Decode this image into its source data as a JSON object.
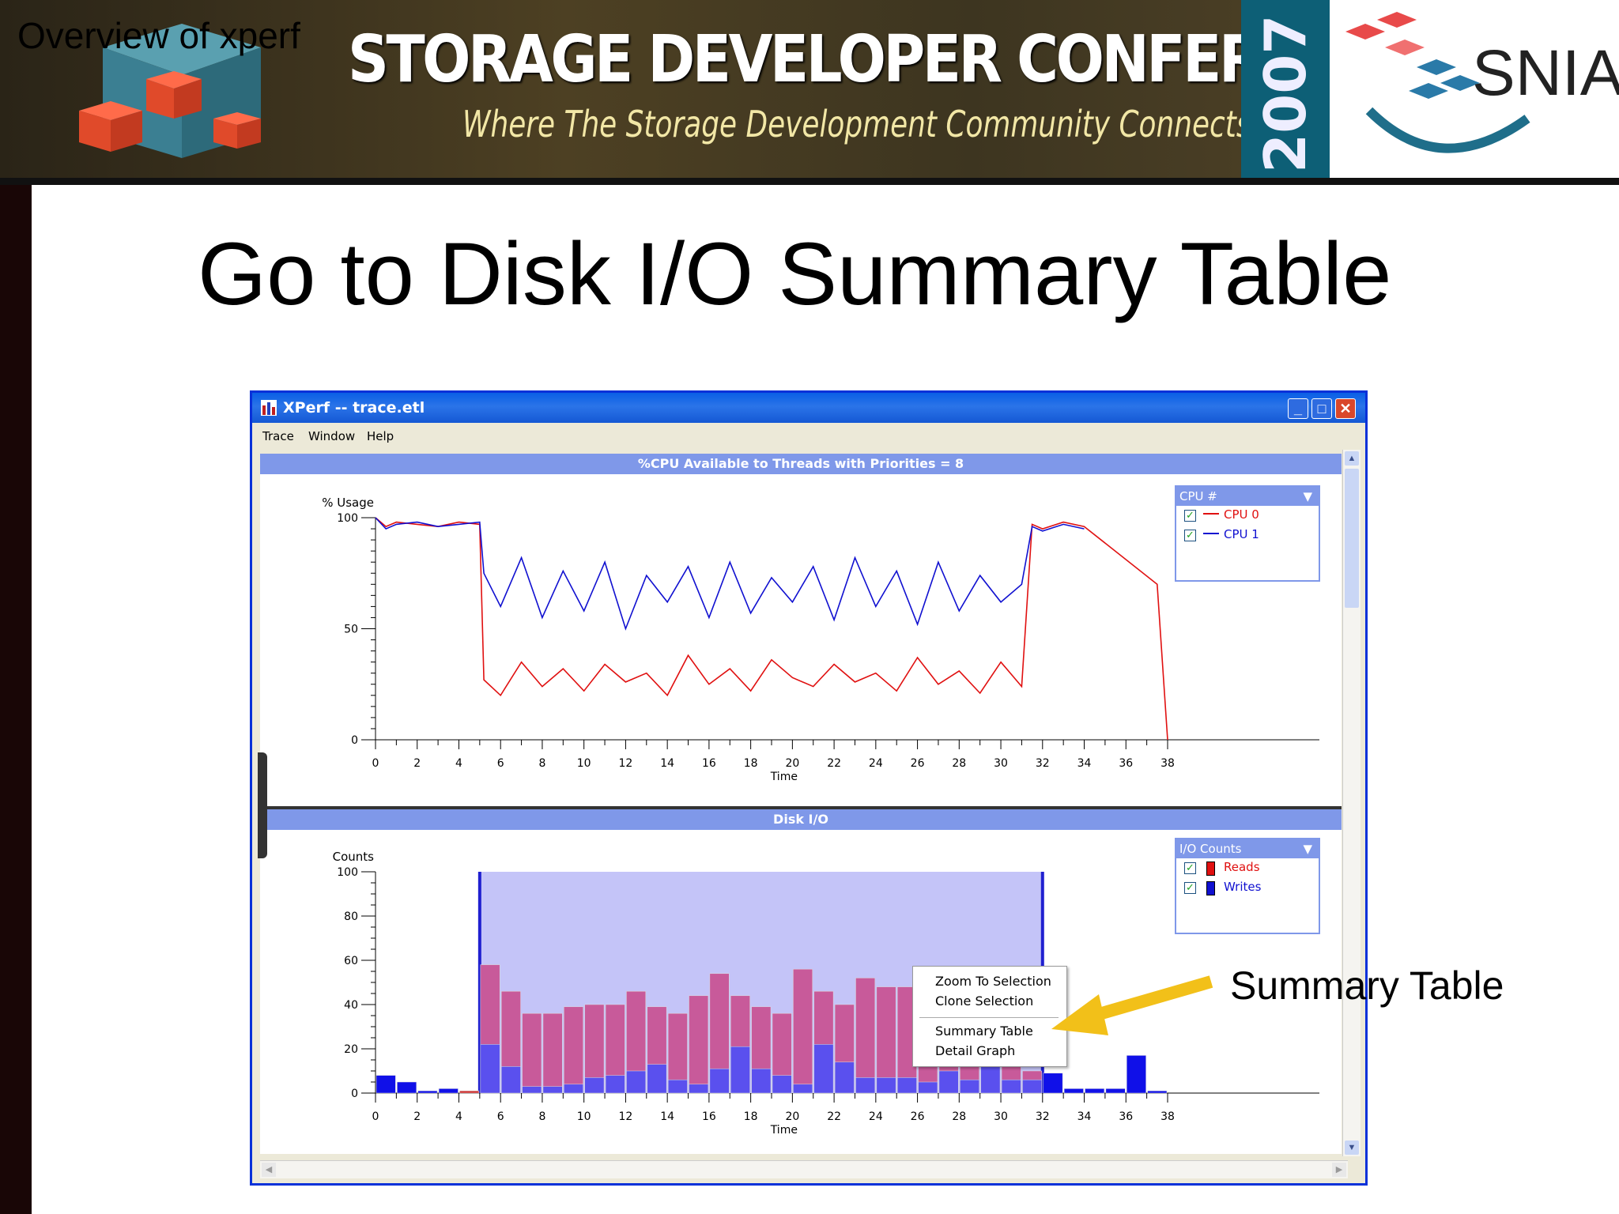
{
  "banner": {
    "overview_label": "Overview of xperf",
    "conference_title": "STORAGE DEVELOPER CONFERENCE",
    "conference_subtitle": "Where The Storage Development Community Connects",
    "year": "2007",
    "org": "SNIA"
  },
  "slide": {
    "title": "Go to Disk I/O Summary Table",
    "annotation": "Summary Table",
    "colors": {
      "arrow": "#f2c019",
      "title": "#000000"
    }
  },
  "window": {
    "title": "XPerf -- trace.etl",
    "menu": [
      "Trace",
      "Window",
      "Help"
    ],
    "buttons": {
      "minimize": "_",
      "maximize": "□",
      "close": "✕"
    }
  },
  "cpu_panel": {
    "header": "%CPU Available to Threads with Priorities = 8",
    "legend_title": "CPU #",
    "legend_items": [
      {
        "label": "CPU 0",
        "color": "#e01010"
      },
      {
        "label": "CPU 1",
        "color": "#1010d0"
      }
    ]
  },
  "disk_panel": {
    "header": "Disk I/O",
    "legend_title": "I/O Counts",
    "legend_items": [
      {
        "label": "Reads",
        "color": "#e01010"
      },
      {
        "label": "Writes",
        "color": "#1010d0"
      }
    ]
  },
  "context_menu": {
    "items": [
      "Zoom To Selection",
      "Clone Selection",
      "Summary Table",
      "Detail Graph"
    ]
  },
  "chart_data": [
    {
      "type": "line",
      "title": "%CPU Available to Threads with Priorities = 8",
      "ylabel": "% Usage",
      "xlabel": "Time",
      "ylim": [
        0,
        100
      ],
      "xlim": [
        0,
        38
      ],
      "yticks": [
        0,
        50,
        100
      ],
      "xticks": [
        0,
        2,
        4,
        6,
        8,
        10,
        12,
        14,
        16,
        18,
        20,
        22,
        24,
        26,
        28,
        30,
        32,
        34,
        36,
        38
      ],
      "series": [
        {
          "name": "CPU 0",
          "x": [
            0,
            0.5,
            1,
            2,
            3,
            4,
            5,
            5.2,
            6,
            7,
            8,
            9,
            10,
            11,
            12,
            13,
            14,
            15,
            16,
            17,
            18,
            19,
            20,
            21,
            22,
            23,
            24,
            25,
            26,
            27,
            28,
            29,
            30,
            31,
            31.5,
            32,
            33,
            34,
            37.5,
            38
          ],
          "y": [
            100,
            96,
            98,
            97,
            96,
            98,
            97,
            27,
            20,
            35,
            24,
            32,
            22,
            34,
            26,
            30,
            20,
            38,
            25,
            32,
            22,
            36,
            28,
            24,
            34,
            26,
            30,
            22,
            37,
            25,
            31,
            21,
            35,
            24,
            97,
            95,
            98,
            96,
            70,
            0
          ]
        },
        {
          "name": "CPU 1",
          "x": [
            0,
            0.5,
            1,
            2,
            3,
            4,
            5,
            5.2,
            6,
            7,
            8,
            9,
            10,
            11,
            12,
            13,
            14,
            15,
            16,
            17,
            18,
            19,
            20,
            21,
            22,
            23,
            24,
            25,
            26,
            27,
            28,
            29,
            30,
            31,
            31.5,
            32,
            33,
            34
          ],
          "y": [
            100,
            95,
            97,
            98,
            96,
            97,
            98,
            75,
            60,
            82,
            55,
            76,
            58,
            80,
            50,
            74,
            62,
            78,
            55,
            80,
            57,
            73,
            62,
            78,
            54,
            82,
            60,
            76,
            52,
            80,
            58,
            74,
            62,
            70,
            96,
            94,
            97,
            95
          ]
        }
      ]
    },
    {
      "type": "bar",
      "title": "Disk I/O",
      "ylabel": "Counts",
      "xlabel": "Time",
      "ylim": [
        0,
        100
      ],
      "xlim": [
        0,
        38
      ],
      "yticks": [
        0,
        20,
        40,
        60,
        80,
        100
      ],
      "xticks": [
        0,
        2,
        4,
        6,
        8,
        10,
        12,
        14,
        16,
        18,
        20,
        22,
        24,
        26,
        28,
        30,
        32,
        34,
        36,
        38
      ],
      "selection_range": [
        5,
        32
      ],
      "categories": [
        0,
        1,
        2,
        3,
        4,
        5,
        6,
        7,
        8,
        9,
        10,
        11,
        12,
        13,
        14,
        15,
        16,
        17,
        18,
        19,
        20,
        21,
        22,
        23,
        24,
        25,
        26,
        27,
        28,
        29,
        30,
        31,
        32,
        33,
        34,
        35,
        36,
        37
      ],
      "series": [
        {
          "name": "Reads",
          "values": [
            0,
            0,
            0,
            0,
            1,
            58,
            46,
            36,
            36,
            39,
            40,
            40,
            46,
            39,
            36,
            44,
            54,
            44,
            39,
            36,
            56,
            46,
            40,
            52,
            48,
            48,
            46,
            48,
            54,
            46,
            46,
            10,
            1,
            1,
            1,
            1,
            0,
            0
          ]
        },
        {
          "name": "Writes",
          "values": [
            8,
            5,
            1,
            2,
            0,
            22,
            12,
            3,
            3,
            4,
            7,
            8,
            10,
            13,
            6,
            4,
            11,
            21,
            11,
            8,
            4,
            22,
            14,
            7,
            7,
            7,
            5,
            10,
            6,
            22,
            6,
            6,
            9,
            2,
            2,
            2,
            17,
            1
          ]
        }
      ]
    }
  ]
}
